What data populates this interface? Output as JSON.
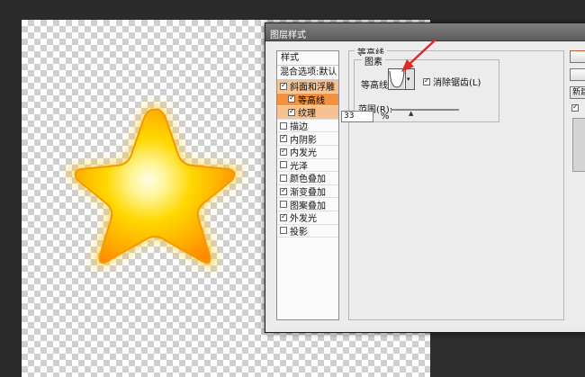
{
  "dialog": {
    "title": "图层样式"
  },
  "styles_panel": {
    "header": "样式",
    "blend_options": "混合选项:默认",
    "items": [
      {
        "label": "斜面和浮雕",
        "checked": true,
        "state": "selected-light"
      },
      {
        "label": "等高线",
        "checked": true,
        "state": "selected",
        "sub": true
      },
      {
        "label": "纹理",
        "checked": true,
        "state": "selected-light",
        "sub": true
      },
      {
        "label": "描边",
        "checked": false
      },
      {
        "label": "内阴影",
        "checked": true
      },
      {
        "label": "内发光",
        "checked": true
      },
      {
        "label": "光泽",
        "checked": false
      },
      {
        "label": "颜色叠加",
        "checked": false
      },
      {
        "label": "渐变叠加",
        "checked": true
      },
      {
        "label": "图案叠加",
        "checked": false
      },
      {
        "label": "外发光",
        "checked": true
      },
      {
        "label": "投影",
        "checked": false
      }
    ]
  },
  "contour_settings": {
    "group_title": "等高线",
    "subgroup_title": "图素",
    "contour_label": "等高线:",
    "anti_alias_label": "消除锯齿(L)",
    "anti_alias_checked": true,
    "range_label": "范围(R):",
    "range_value": "33",
    "range_unit": "%"
  },
  "buttons": {
    "new_label": "新建"
  },
  "colors": {
    "selected": "#f39140",
    "selected_light": "#f6c291",
    "arrow": "#e02a2a",
    "star_gold": "#ffcc00"
  }
}
